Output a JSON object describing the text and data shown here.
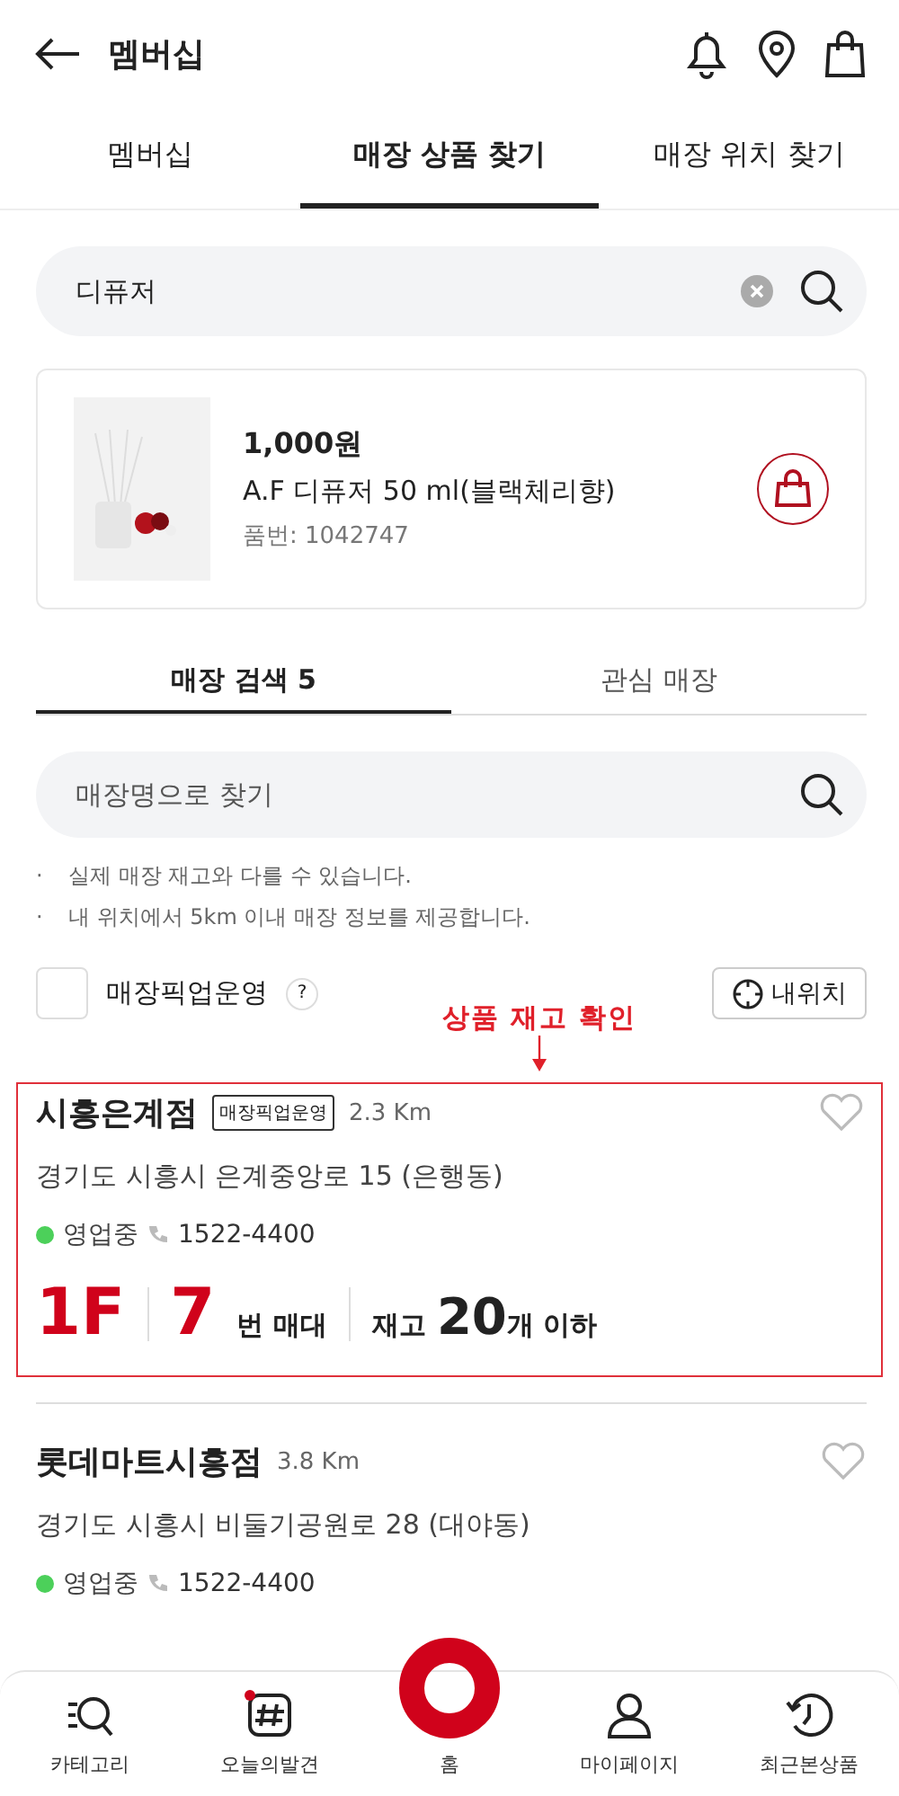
{
  "header": {
    "title": "멤버십"
  },
  "tabs": [
    {
      "label": "멤버십",
      "selected": false
    },
    {
      "label": "매장 상품 찾기",
      "selected": true
    },
    {
      "label": "매장 위치 찾기",
      "selected": false
    }
  ],
  "search": {
    "value": "디퓨저"
  },
  "product": {
    "kind": "picture",
    "price": "1,000원",
    "name": "A.F 디퓨저 50 ml(블랙체리향)",
    "code": "품번: 1042747"
  },
  "store_tabs": [
    {
      "label": "매장 검색 5",
      "selected": true
    },
    {
      "label": "관심 매장",
      "selected": false
    }
  ],
  "store_search": {
    "placeholder": "매장명으로 찾기"
  },
  "notes": [
    {
      "marker": "·",
      "text": "실제 매장 재고와 다를 수 있습니다."
    },
    {
      "marker": "·",
      "text": "내 위치에서 5km 이내 매장 정보를 제공합니다."
    }
  ],
  "pickup_filter": {
    "label": "매장픽업운영",
    "help": "?",
    "checked": false
  },
  "my_location_button": "내위치",
  "annotation": "상품 재고 확인",
  "stores": [
    {
      "name": "시흥은계점",
      "badge": "매장픽업운영",
      "distance": "2.3 Km",
      "address": "경기도 시흥시 은계중앙로 15 (은행동)",
      "status": "영업중",
      "phone": "1522-4400",
      "favorite": false,
      "highlighted": true,
      "floor": "1F",
      "shelf": "7",
      "shelf_unit": "번 매대",
      "stock_label": "재고",
      "stock": "20",
      "stock_unit": "개 이하"
    },
    {
      "name": "롯데마트시흥점",
      "distance": "3.8 Km",
      "address": "경기도 시흥시 비둘기공원로 28 (대야동)",
      "status": "영업중",
      "phone": "1522-4400",
      "favorite": false,
      "highlighted": false
    }
  ],
  "bottom_nav": [
    {
      "kind": "category",
      "label": "카테고리",
      "dot": false
    },
    {
      "kind": "discover",
      "label": "오늘의발견",
      "dot": true
    },
    {
      "kind": "home",
      "label": "홈",
      "dot": false
    },
    {
      "kind": "mypage",
      "label": "마이페이지",
      "dot": false
    },
    {
      "kind": "recent",
      "label": "최근본상품",
      "dot": false
    }
  ]
}
